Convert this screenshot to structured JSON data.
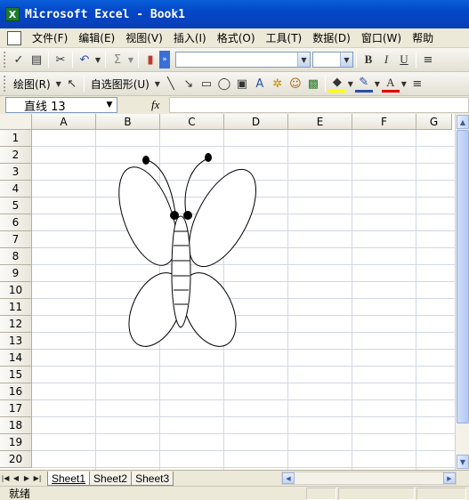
{
  "app": {
    "title": "Microsoft Excel - Book1"
  },
  "menu": {
    "items": [
      "文件(F)",
      "编辑(E)",
      "视图(V)",
      "插入(I)",
      "格式(O)",
      "工具(T)",
      "数据(D)",
      "窗口(W)",
      "帮助"
    ]
  },
  "formatting": {
    "bold": "B",
    "italic": "I",
    "underline": "U"
  },
  "drawing": {
    "draw_label": "绘图(R)",
    "autoshapes_label": "自选图形(U)"
  },
  "formula_bar": {
    "name_box": "直线 13",
    "fx": "fx"
  },
  "grid": {
    "columns": [
      "A",
      "B",
      "C",
      "D",
      "E",
      "F",
      "G"
    ],
    "rows": [
      "1",
      "2",
      "3",
      "4",
      "5",
      "6",
      "7",
      "8",
      "9",
      "10",
      "11",
      "12",
      "13",
      "14",
      "15",
      "16",
      "17",
      "18",
      "19",
      "20"
    ]
  },
  "sheets": {
    "tabs": [
      "Sheet1",
      "Sheet2",
      "Sheet3"
    ],
    "active": "Sheet1"
  },
  "status": {
    "text": "就绪"
  },
  "colors": {
    "title_bar": "#0347c8",
    "grid_line": "#d0d7e5",
    "chrome": "#ece9d8"
  }
}
